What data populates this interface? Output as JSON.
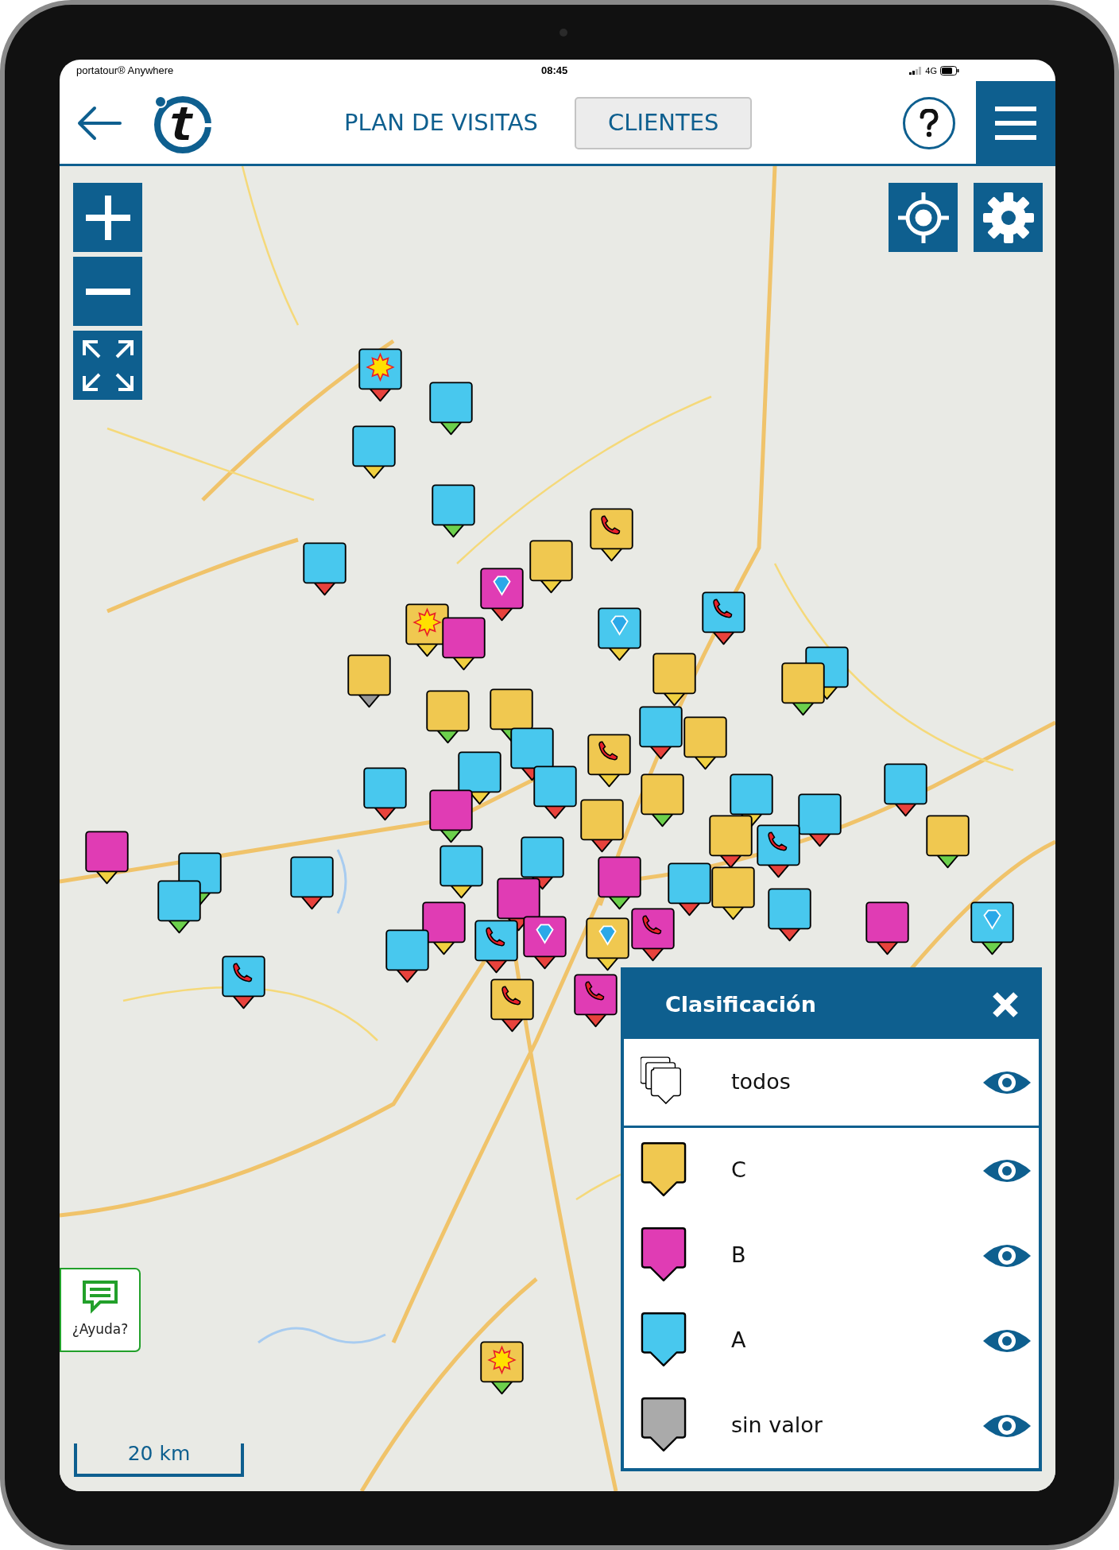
{
  "status_bar": {
    "app": "portatour® Anywhere",
    "time": "08:45",
    "network": "4G"
  },
  "header": {
    "tabs": [
      {
        "label": "PLAN DE VISITAS",
        "selected": false
      },
      {
        "label": "CLIENTES",
        "selected": true
      }
    ]
  },
  "map": {
    "pins": [
      {
        "color": "#48c8ee",
        "status": {
          "color": "#e8423c"
        },
        "kind": "sun"
      },
      {
        "color": "#48c8ee",
        "status": {
          "color": "#6cd04c"
        },
        "kind": "plain"
      },
      {
        "color": "#48c8ee",
        "status": {
          "color": "#f0d040"
        },
        "kind": "plain"
      },
      {
        "color": "#48c8ee",
        "status": {
          "color": "#6cd04c"
        },
        "kind": "plain"
      },
      {
        "color": "#48c8ee",
        "status": {
          "color": "#e8423c"
        },
        "kind": "plain"
      },
      {
        "color": "#f0c850",
        "status": {
          "color": "#f0d040"
        },
        "kind": "phone"
      },
      {
        "color": "#f0c850",
        "status": {
          "color": "#f0d040"
        },
        "kind": "plain"
      },
      {
        "color": "#e03cb4",
        "status": {
          "color": "#e8423c"
        },
        "kind": "diamond"
      },
      {
        "color": "#48c8ee",
        "status": {
          "color": "#f0d040"
        },
        "kind": "diamond"
      },
      {
        "color": "#48c8ee",
        "status": {
          "color": "#e8423c"
        },
        "kind": "phone"
      },
      {
        "color": "#f0c850",
        "status": {
          "color": "#f0d040"
        },
        "kind": "sun"
      },
      {
        "color": "#e03cb4",
        "status": {
          "color": "#f0d040"
        },
        "kind": "plain"
      },
      {
        "color": "#f0c850",
        "status": {
          "color": "#999999"
        },
        "kind": "plain"
      },
      {
        "color": "#f0c850",
        "status": {
          "color": "#f0d040"
        },
        "kind": "plain"
      },
      {
        "color": "#48c8ee",
        "status": {
          "color": "#f0d040"
        },
        "kind": "plain"
      },
      {
        "color": "#f0c850",
        "status": {
          "color": "#6cd04c"
        },
        "kind": "plain"
      },
      {
        "color": "#f0c850",
        "status": {
          "color": "#6cd04c"
        },
        "kind": "plain"
      },
      {
        "color": "#f0c850",
        "status": {
          "color": "#6cd04c"
        },
        "kind": "plain"
      },
      {
        "color": "#48c8ee",
        "status": {
          "color": "#e8423c"
        },
        "kind": "plain"
      },
      {
        "color": "#f0c850",
        "status": {
          "color": "#f0d040"
        },
        "kind": "plain"
      },
      {
        "color": "#f0c850",
        "status": {
          "color": "#f0d040"
        },
        "kind": "phone"
      },
      {
        "color": "#48c8ee",
        "status": {
          "color": "#e8423c"
        },
        "kind": "plain"
      },
      {
        "color": "#48c8ee",
        "status": {
          "color": "#f0d040"
        },
        "kind": "plain"
      },
      {
        "color": "#48c8ee",
        "status": {
          "color": "#e8423c"
        },
        "kind": "plain"
      },
      {
        "color": "#48c8ee",
        "status": {
          "color": "#e8423c"
        },
        "kind": "plain"
      },
      {
        "color": "#f0c850",
        "status": {
          "color": "#6cd04c"
        },
        "kind": "plain"
      },
      {
        "color": "#48c8ee",
        "status": {
          "color": "#f0d040"
        },
        "kind": "plain"
      },
      {
        "color": "#48c8ee",
        "status": {
          "color": "#e8423c"
        },
        "kind": "plain"
      },
      {
        "color": "#e03cb4",
        "status": {
          "color": "#6cd04c"
        },
        "kind": "plain"
      },
      {
        "color": "#f0c850",
        "status": {
          "color": "#e8423c"
        },
        "kind": "plain"
      },
      {
        "color": "#48c8ee",
        "status": {
          "color": "#e8423c"
        },
        "kind": "plain"
      },
      {
        "color": "#f0c850",
        "status": {
          "color": "#6cd04c"
        },
        "kind": "plain"
      },
      {
        "color": "#f0c850",
        "status": {
          "color": "#e8423c"
        },
        "kind": "plain"
      },
      {
        "color": "#48c8ee",
        "status": {
          "color": "#e8423c"
        },
        "kind": "phone"
      },
      {
        "color": "#e03cb4",
        "status": {
          "color": "#f0d040"
        },
        "kind": "plain"
      },
      {
        "color": "#48c8ee",
        "status": {
          "color": "#6cd04c"
        },
        "kind": "plain"
      },
      {
        "color": "#48c8ee",
        "status": {
          "color": "#e8423c"
        },
        "kind": "plain"
      },
      {
        "color": "#48c8ee",
        "status": {
          "color": "#f0d040"
        },
        "kind": "plain"
      },
      {
        "color": "#48c8ee",
        "status": {
          "color": "#e8423c"
        },
        "kind": "plain"
      },
      {
        "color": "#e03cb4",
        "status": {
          "color": "#6cd04c"
        },
        "kind": "plain"
      },
      {
        "color": "#48c8ee",
        "status": {
          "color": "#e8423c"
        },
        "kind": "plain"
      },
      {
        "color": "#f0c850",
        "status": {
          "color": "#f0d040"
        },
        "kind": "plain"
      },
      {
        "color": "#48c8ee",
        "status": {
          "color": "#6cd04c"
        },
        "kind": "plain"
      },
      {
        "color": "#e03cb4",
        "status": {
          "color": "#f0d040"
        },
        "kind": "plain"
      },
      {
        "color": "#e03cb4",
        "status": {
          "color": "#e8423c"
        },
        "kind": "plain"
      },
      {
        "color": "#48c8ee",
        "status": {
          "color": "#e8423c"
        },
        "kind": "plain"
      },
      {
        "color": "#e03cb4",
        "status": {
          "color": "#e8423c"
        },
        "kind": "plain"
      },
      {
        "color": "#48c8ee",
        "status": {
          "color": "#6cd04c"
        },
        "kind": "diamond"
      },
      {
        "color": "#48c8ee",
        "status": {
          "color": "#e8423c"
        },
        "kind": "plain"
      },
      {
        "color": "#48c8ee",
        "status": {
          "color": "#e8423c"
        },
        "kind": "phone"
      },
      {
        "color": "#e03cb4",
        "status": {
          "color": "#e8423c"
        },
        "kind": "diamond"
      },
      {
        "color": "#f0c850",
        "status": {
          "color": "#f0d040"
        },
        "kind": "diamond"
      },
      {
        "color": "#e03cb4",
        "status": {
          "color": "#e8423c"
        },
        "kind": "phone"
      },
      {
        "color": "#48c8ee",
        "status": {
          "color": "#e8423c"
        },
        "kind": "phone"
      },
      {
        "color": "#e03cb4",
        "status": {
          "color": "#e8423c"
        },
        "kind": "phone"
      },
      {
        "color": "#f0c850",
        "status": {
          "color": "#e8423c"
        },
        "kind": "phone"
      },
      {
        "color": "#f0c850",
        "status": {
          "color": "#6cd04c"
        },
        "kind": "sun"
      }
    ]
  },
  "legend": {
    "title": "Clasificación",
    "items": [
      {
        "kind": "all",
        "label": "todos",
        "visible": true
      },
      {
        "kind": "class",
        "label": "C",
        "color": "#f0c850",
        "visible": true
      },
      {
        "kind": "class",
        "label": "B",
        "color": "#e03cb4",
        "visible": true
      },
      {
        "kind": "class",
        "label": "A",
        "color": "#48c8ee",
        "visible": true
      },
      {
        "kind": "class",
        "label": "sin valor",
        "color": "#aaaaaa",
        "visible": true
      }
    ]
  },
  "help_button": {
    "label": "¿Ayuda?"
  },
  "scale": {
    "label": "20 km"
  }
}
